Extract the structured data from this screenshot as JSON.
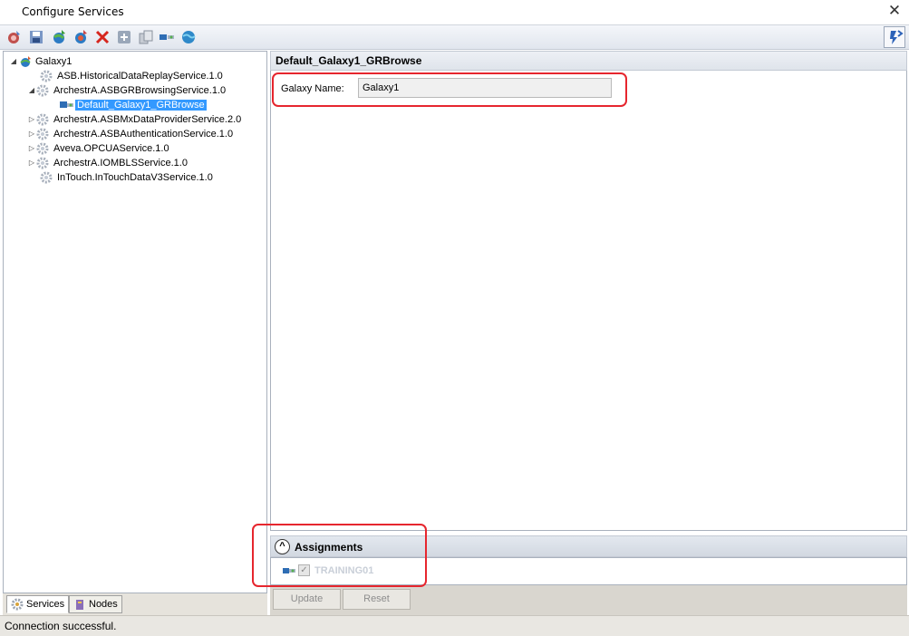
{
  "window": {
    "title": "Configure Services"
  },
  "toolbar": {
    "icons": [
      "deploy-icon",
      "save-icon",
      "add-galaxy-icon",
      "add-service-icon",
      "delete-icon",
      "add-icon",
      "copy-icon",
      "assign-icon",
      "globe-icon",
      "refresh-icon"
    ]
  },
  "tree": {
    "root": "Galaxy1",
    "items": [
      {
        "label": "ASB.HistoricalDataReplayService.1.0"
      },
      {
        "label": "ArchestrA.ASBGRBrowsingService.1.0"
      },
      {
        "label": "Default_Galaxy1_GRBrowse"
      },
      {
        "label": "ArchestrA.ASBMxDataProviderService.2.0"
      },
      {
        "label": "ArchestrA.ASBAuthenticationService.1.0"
      },
      {
        "label": "Aveva.OPCUAService.1.0"
      },
      {
        "label": "ArchestrA.IOMBLSService.1.0"
      },
      {
        "label": "InTouch.InTouchDataV3Service.1.0"
      }
    ]
  },
  "left_tabs": {
    "services": "Services",
    "nodes": "Nodes"
  },
  "detail": {
    "header": "Default_Galaxy1_GRBrowse",
    "galaxy_name_label": "Galaxy Name:",
    "galaxy_name_value": "Galaxy1"
  },
  "assignments": {
    "title": "Assignments",
    "items": [
      {
        "name": "TRAINING01",
        "checked": true
      }
    ]
  },
  "buttons": {
    "update": "Update",
    "reset": "Reset"
  },
  "status": {
    "text": "Connection successful."
  },
  "colors": {
    "selection": "#3399ff",
    "annotation": "#e6262e"
  }
}
